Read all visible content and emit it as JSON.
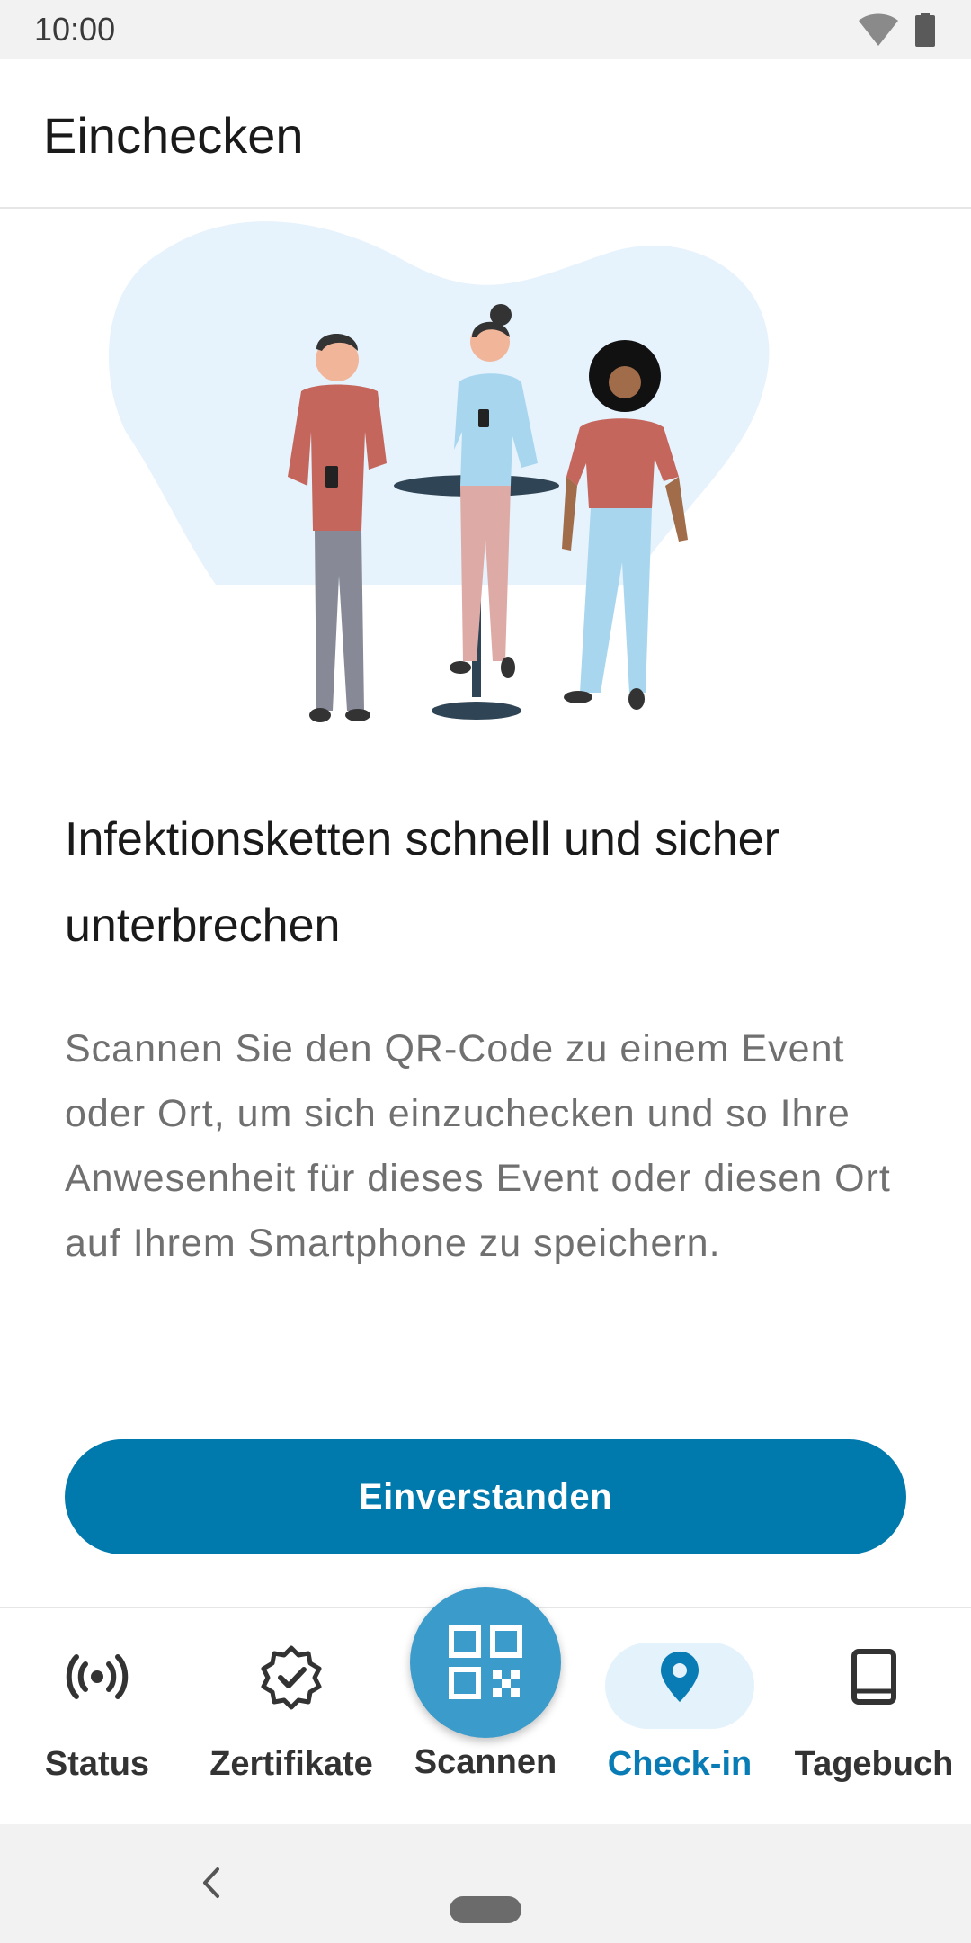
{
  "status_bar": {
    "time": "10:00",
    "icons": [
      "wifi-icon",
      "battery-icon"
    ]
  },
  "app_bar": {
    "title": "Einchecken"
  },
  "illustration": {
    "description_icon": "people-at-table-illustration"
  },
  "content": {
    "headline": "Infektionsketten schnell und sicher unterbrechen",
    "body": "Scannen Sie den QR-Code zu einem Event oder Ort, um sich einzuchecken und so Ihre Anwesenheit für dieses Event oder diesen Ort auf Ihrem Smartphone zu speichern.",
    "primary_button": "Einverstanden"
  },
  "bottom_nav": {
    "items": [
      {
        "label": "Status",
        "icon": "broadcast-icon",
        "active": false
      },
      {
        "label": "Zertifikate",
        "icon": "certificate-check-icon",
        "active": false
      },
      {
        "label": "Scannen",
        "icon": "qr-code-icon",
        "active": false
      },
      {
        "label": "Check-in",
        "icon": "location-pin-icon",
        "active": true
      },
      {
        "label": "Tagebuch",
        "icon": "book-icon",
        "active": false
      }
    ]
  },
  "colors": {
    "primary": "#0079ad",
    "fab": "#3b9bcb",
    "active_label": "#0a7cb5",
    "active_pill": "#e3f2fb",
    "blob": "#e6f2fc"
  }
}
